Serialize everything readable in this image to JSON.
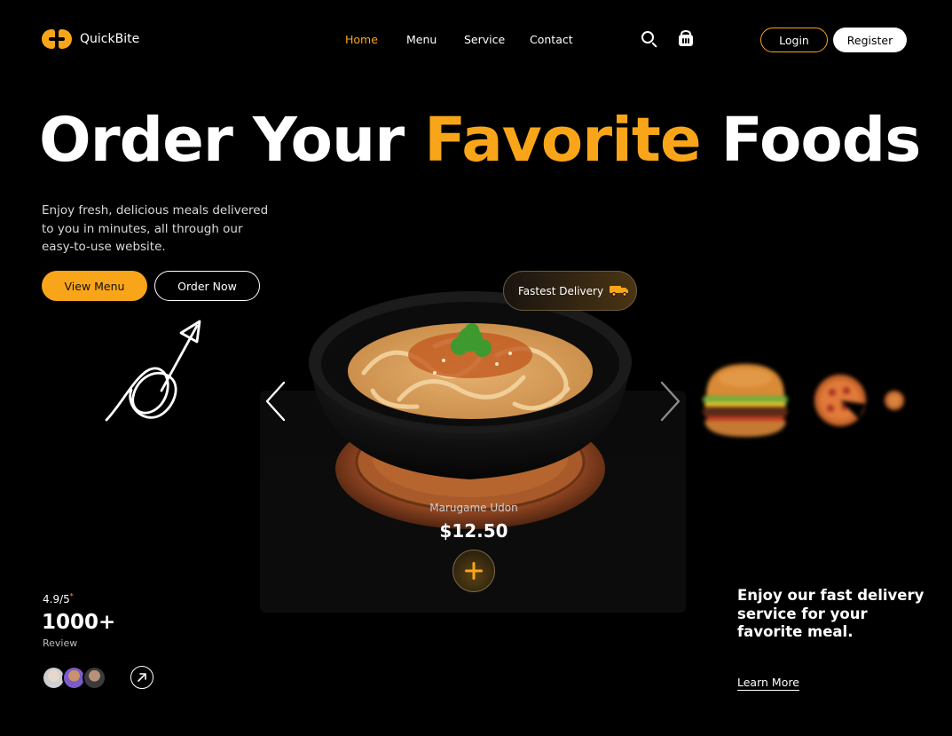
{
  "brand": {
    "name": "QuickBite",
    "accent": "#f9a51a"
  },
  "nav": {
    "items": [
      "Home",
      "Menu",
      "Service",
      "Contact"
    ],
    "active": "Home"
  },
  "header": {
    "login_label": "Login",
    "register_label": "Register",
    "icons": [
      "search-icon",
      "basket-icon"
    ]
  },
  "hero": {
    "title_part1": "Order Your ",
    "title_highlight": "Favorite",
    "title_part2": " Foods",
    "subtitle": "Enjoy fresh, delicious meals delivered to you in minutes, all through our easy-to-use website.",
    "view_menu_label": "View Menu",
    "order_now_label": "Order Now"
  },
  "featured": {
    "badge_label": "Fastest Delivery",
    "name": "Marugame Udon",
    "price": "$12.50"
  },
  "stats": {
    "rating": "4.9/5",
    "rating_mark": "*",
    "review_count": "1000+",
    "review_label": "Review"
  },
  "promo": {
    "text": "Enjoy our fast delivery service for your favorite meal.",
    "link_label": "Learn More"
  }
}
